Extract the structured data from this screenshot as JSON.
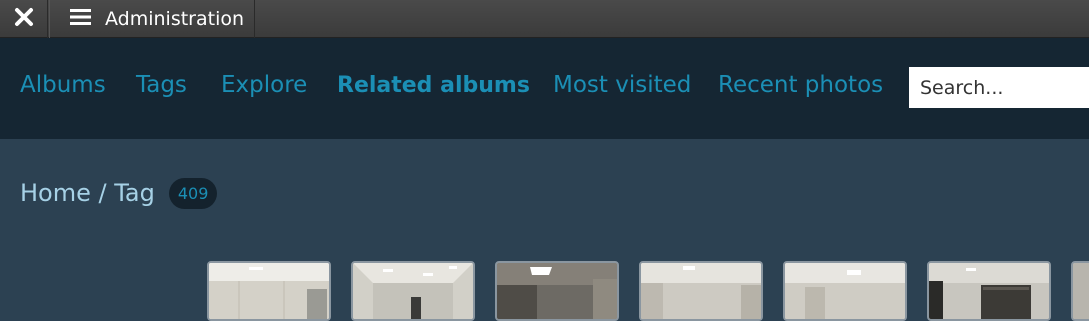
{
  "admin_bar": {
    "close_icon": "close-icon",
    "menu_icon": "hamburger-menu-icon",
    "title": "Administration"
  },
  "nav": {
    "items": [
      {
        "label": "Albums",
        "active": false
      },
      {
        "label": "Tags",
        "active": false
      },
      {
        "label": "Explore",
        "active": false
      },
      {
        "label": "Related albums",
        "active": true
      },
      {
        "label": "Most visited",
        "active": false
      },
      {
        "label": "Recent photos",
        "active": false
      }
    ],
    "search_placeholder": "Search..."
  },
  "breadcrumb": {
    "path": "Home / Tag",
    "count": "409"
  },
  "thumbnails": [
    {
      "variant": "bright"
    },
    {
      "variant": "ceiling-lights"
    },
    {
      "variant": "dark"
    },
    {
      "variant": "bright-light"
    },
    {
      "variant": "bright-light"
    },
    {
      "variant": "dark-doorway"
    }
  ],
  "colors": {
    "accent": "#1b8fb5",
    "nav_background": "#152633",
    "page_background": "#2c4152",
    "breadcrumb_text": "#a6d1e6"
  }
}
